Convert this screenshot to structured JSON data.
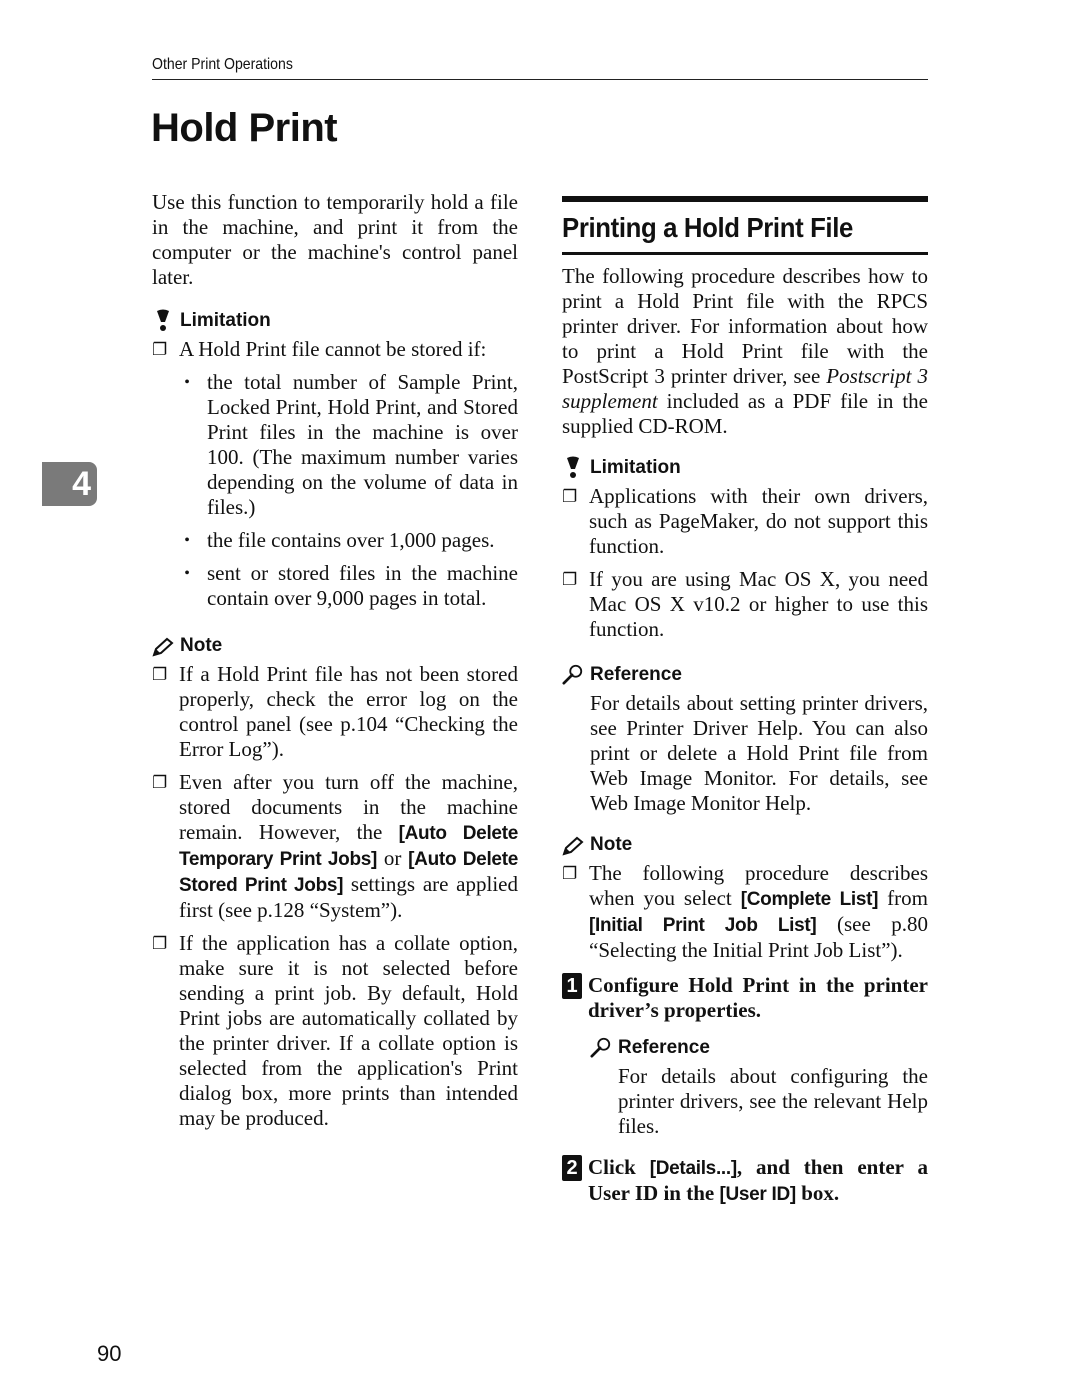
{
  "running_head": "Other Print Operations",
  "page_title": "Hold Print",
  "chapter_tab": "4",
  "page_number": "90",
  "left": {
    "intro": "Use this function to temporarily hold a file in the machine, and print it from the computer or the machine's control panel later.",
    "limitation": {
      "heading": "Limitation",
      "item": "A Hold Print file cannot be stored if:",
      "bullets": [
        "the total number of Sample Print, Locked Print, Hold Print, and Stored Print files in the machine is over 100. (The maximum number varies depending on the volume of data in files.)",
        "the file contains over 1,000 pages.",
        "sent or stored files in the machine contain over 9,000 pages in total."
      ]
    },
    "note": {
      "heading": "Note",
      "item1": "If a Hold Print file has not been stored properly, check the error log on the control panel (see p.104 “Checking the Error Log”).",
      "item2": {
        "pre": "Even after you turn off the machine, stored documents in the machine remain. However, the ",
        "btn1": "[Auto Delete Temporary Print Jobs]",
        "mid": " or ",
        "btn2": "[Auto Delete Stored Print Jobs]",
        "post": " settings are applied first (see p.128 “System”)."
      },
      "item3": "If the application has a collate option, make sure it is not selected before sending a print job. By default, Hold Print jobs are automatically collated by the printer driver. If a collate option is selected from the application's Print dialog box, more prints than intended may be produced."
    }
  },
  "right": {
    "heading": "Printing a Hold Print File",
    "intro": {
      "pre": "The following procedure describes how to print a Hold Print file with the RPCS printer driver. For information about how to print a Hold Print file with the PostScript 3 printer driver, see ",
      "italic": "Postscript 3 supplement",
      "post": " included as a PDF file in the supplied CD-ROM."
    },
    "limitation": {
      "heading": "Limitation",
      "items": [
        "Applications with their own drivers, such as PageMaker, do not support this function.",
        "If you are using Mac OS X, you need Mac OS X v10.2 or higher to use this function."
      ]
    },
    "reference": {
      "heading": "Reference",
      "text": "For details about setting printer drivers, see Printer Driver Help. You can also print or delete a Hold Print file from Web Image Monitor. For details, see Web Image Monitor Help."
    },
    "note": {
      "heading": "Note",
      "pre": "The following procedure describes when you select ",
      "btn1": "[Complete List]",
      "mid": " from ",
      "btn2": "[Initial Print Job List]",
      "post": " (see p.80 “Selecting the Initial Print Job List”)."
    },
    "steps": [
      {
        "number": "1",
        "text": "Configure Hold Print in the printer driver’s properties.",
        "reference": {
          "heading": "Reference",
          "text": "For details about configuring the printer drivers, see the relevant Help files."
        }
      },
      {
        "number": "2",
        "pre": "Click ",
        "btn1": "[Details...]",
        "mid": ", and then enter a User ID in the ",
        "btn2": "[User ID]",
        "post": " box."
      }
    ]
  }
}
